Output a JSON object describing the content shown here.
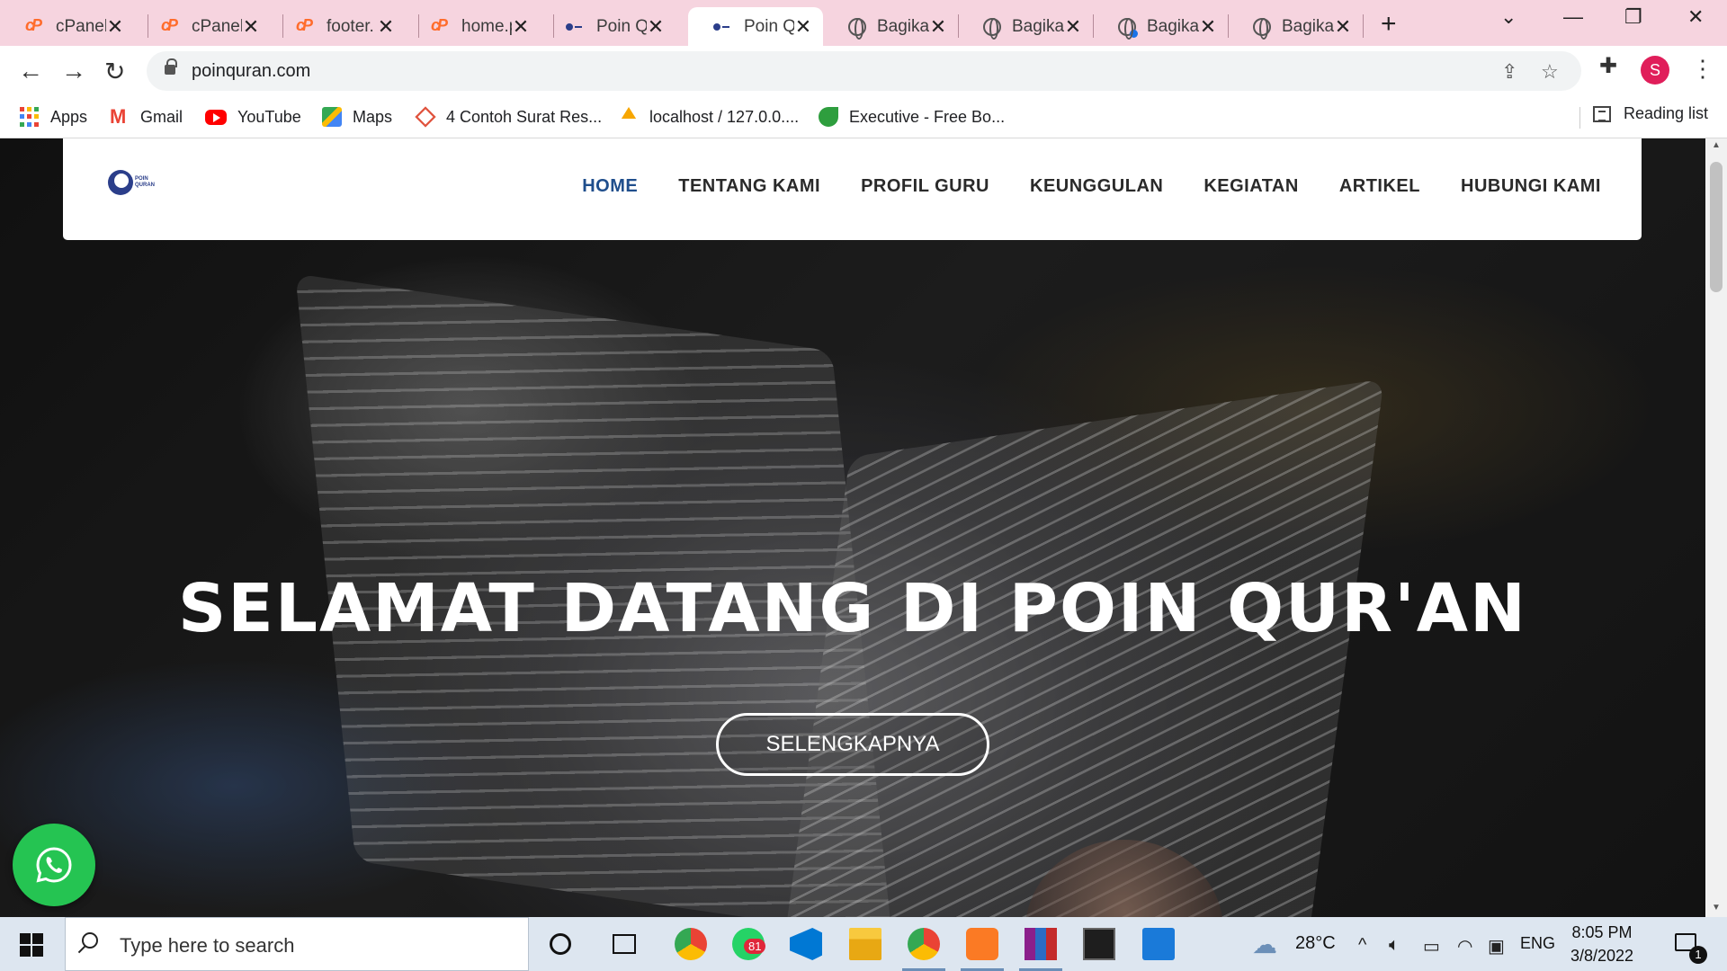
{
  "browser": {
    "tabs": [
      {
        "title": "cPanel",
        "icon": "cpanel-icon"
      },
      {
        "title": "cPanel",
        "icon": "cpanel-icon"
      },
      {
        "title": "footer.",
        "icon": "cpanel-icon"
      },
      {
        "title": "home.p",
        "icon": "cpanel-icon"
      },
      {
        "title": "Poin Q",
        "icon": "poinquran-icon"
      },
      {
        "title": "Poin Q",
        "icon": "poinquran-icon",
        "active": true
      },
      {
        "title": "Bagika",
        "icon": "globe-icon"
      },
      {
        "title": "Bagika",
        "icon": "globe-icon"
      },
      {
        "title": "Bagika",
        "icon": "globe-icon"
      },
      {
        "title": "Bagika",
        "icon": "globe-icon"
      }
    ],
    "url": "poinquran.com",
    "profile_initial": "S",
    "bookmarks": [
      {
        "label": "Apps",
        "icon": "apps-icon"
      },
      {
        "label": "Gmail",
        "icon": "gmail-icon"
      },
      {
        "label": "YouTube",
        "icon": "youtube-icon"
      },
      {
        "label": "Maps",
        "icon": "maps-icon"
      },
      {
        "label": "4 Contoh Surat Res...",
        "icon": "bookmark-site-icon"
      },
      {
        "label": "localhost / 127.0.0....",
        "icon": "phpmyadmin-icon"
      },
      {
        "label": "Executive - Free Bo...",
        "icon": "bookmark-site-icon"
      }
    ],
    "reading_list": "Reading list",
    "colors": {
      "tabstrip": "#f6d4df",
      "profile": "#e01e5a"
    }
  },
  "site": {
    "logo_text": "POIN QURAN",
    "nav": [
      "HOME",
      "TENTANG KAMI",
      "PROFIL GURU",
      "KEUNGGULAN",
      "KEGIATAN",
      "ARTIKEL",
      "HUBUNGI KAMI"
    ],
    "active_nav": "HOME",
    "hero_title": "SELAMAT DATANG DI POIN QUR'AN",
    "hero_button": "SELENGKAPNYA",
    "colors": {
      "nav_active": "#1f4e8c",
      "whatsapp": "#25c452"
    }
  },
  "taskbar": {
    "search_placeholder": "Type here to search",
    "whatsapp_badge": "81",
    "weather": "28°C",
    "language": "ENG",
    "time": "8:05 PM",
    "date": "3/8/2022",
    "notification_count": "1"
  }
}
